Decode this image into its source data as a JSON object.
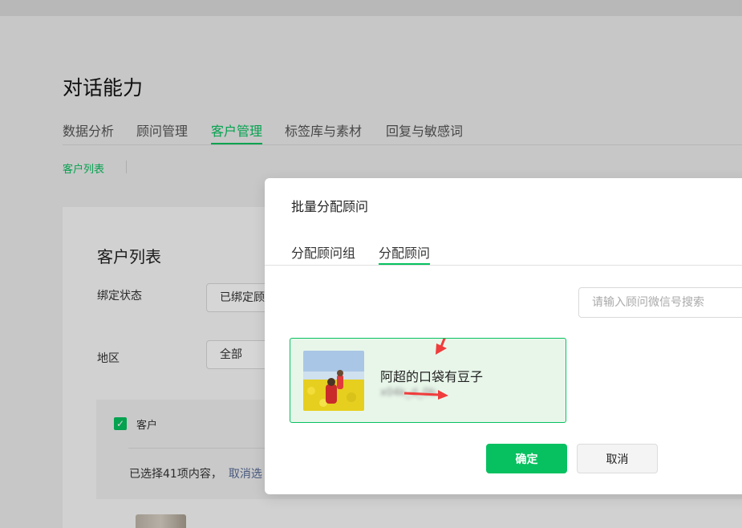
{
  "page": {
    "title": "对话能力",
    "tabs": [
      "数据分析",
      "顾问管理",
      "客户管理",
      "标签库与素材",
      "回复与敏感词"
    ],
    "active_tab": "客户管理",
    "subnav": "客户列表"
  },
  "customer_list": {
    "title": "客户列表",
    "filters": {
      "binding_status": {
        "label": "绑定状态",
        "value": "已绑定顾"
      },
      "region": {
        "label": "地区",
        "value": "全部"
      }
    },
    "table": {
      "column_customer": "客户",
      "selected_text": "已选择41项内容，",
      "cancel_link": "取消选"
    }
  },
  "modal": {
    "title": "批量分配顾问",
    "tabs": [
      "分配顾问组",
      "分配顾问"
    ],
    "active_tab": "分配顾问",
    "search": {
      "placeholder": "请输入顾问微信号搜索",
      "value": ""
    },
    "consultant": {
      "name": "阿超的口袋有豆子",
      "wxid": "x04k_d_0b"
    },
    "confirm_label": "确定",
    "cancel_label": "取消"
  },
  "colors": {
    "accent": "#07c160",
    "link": "#576b95",
    "annotation": "#f03c3c"
  }
}
